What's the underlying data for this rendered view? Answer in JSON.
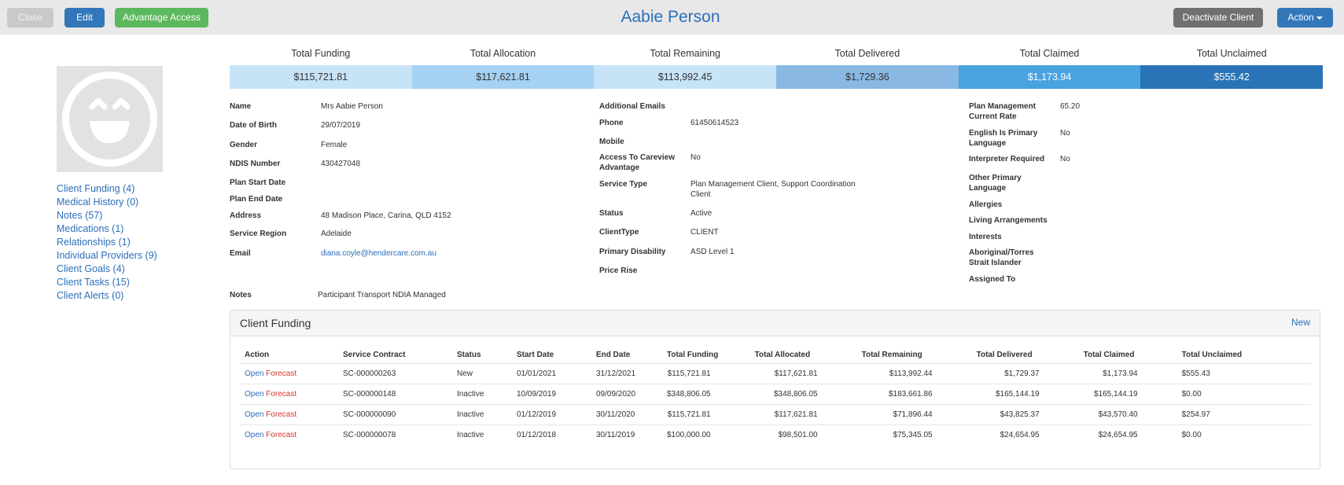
{
  "toolbar": {
    "close_label": "Close",
    "edit_label": "Edit",
    "advantage_label": "Advantage Access",
    "deactivate_label": "Deactivate Client",
    "action_label": "Action"
  },
  "page_title": "Aabie Person",
  "avatar_icon": "smiley-face-icon",
  "sidebar": {
    "items": [
      {
        "label": "Client Funding (4)"
      },
      {
        "label": "Medical History (0)"
      },
      {
        "label": "Notes (57)"
      },
      {
        "label": "Medications (1)"
      },
      {
        "label": "Relationships (1)"
      },
      {
        "label": "Individual Providers (9)"
      },
      {
        "label": "Client Goals (4)"
      },
      {
        "label": "Client Tasks (15)"
      },
      {
        "label": "Client Alerts (0)"
      }
    ]
  },
  "totals": [
    {
      "label": "Total Funding",
      "value": "$115,721.81",
      "color": "#c7e3f7",
      "text_color": "#333333"
    },
    {
      "label": "Total Allocation",
      "value": "$117,621.81",
      "color": "#a5d2f2",
      "text_color": "#333333"
    },
    {
      "label": "Total Remaining",
      "value": "$113,992.45",
      "color": "#c7e3f7",
      "text_color": "#333333"
    },
    {
      "label": "Total Delivered",
      "value": "$1,729.36",
      "color": "#89b9e3",
      "text_color": "#333333"
    },
    {
      "label": "Total Claimed",
      "value": "$1,173.94",
      "color": "#48a3e0",
      "text_color": "#ffffff"
    },
    {
      "label": "Total Unclaimed",
      "value": "$555.42",
      "color": "#2874b6",
      "text_color": "#ffffff"
    }
  ],
  "details": {
    "left": [
      {
        "label": "Name",
        "value": "Mrs Aabie Person"
      },
      {
        "label": "Date of Birth",
        "value": "29/07/2019"
      },
      {
        "label": "Gender",
        "value": "Female"
      },
      {
        "label": "NDIS Number",
        "value": "430427048"
      },
      {
        "label": "Plan Start Date",
        "value": ""
      },
      {
        "label": "Plan End Date",
        "value": ""
      },
      {
        "label": "Address",
        "value": "48 Madison Place, Carina, QLD 4152"
      },
      {
        "label": "Service Region",
        "value": "Adelaide"
      },
      {
        "label": "Email",
        "value": "diana.coyle@hendercare.com.au"
      }
    ],
    "middle": [
      {
        "label": "Additional Emails",
        "value": ""
      },
      {
        "label": "Phone",
        "value": "61450614523"
      },
      {
        "label": "Mobile",
        "value": ""
      },
      {
        "label_1": "Access To Careview",
        "label_2": "Advantage",
        "value": "No"
      },
      {
        "label": "Service Type",
        "value_1": "Plan Management Client, Support Coordination",
        "value_2": "Client"
      },
      {
        "label": "Status",
        "value": "Active"
      },
      {
        "label": "ClientType",
        "value": "CLIENT"
      },
      {
        "label": "Primary Disability",
        "value": "ASD Level 1"
      },
      {
        "label": "Price Rise",
        "value": ""
      }
    ],
    "right": [
      {
        "label_1": "Plan Management",
        "label_2": "Current Rate",
        "value": "65.20"
      },
      {
        "label_1": "English Is Primary",
        "label_2": "Language",
        "value": "No"
      },
      {
        "label": "Interpreter Required",
        "value": "No"
      },
      {
        "label_1": "Other Primary",
        "label_2": "Language",
        "value": ""
      },
      {
        "label": "Allergies",
        "value": ""
      },
      {
        "label": "Living Arrangements",
        "value": ""
      },
      {
        "label": "Interests",
        "value": ""
      },
      {
        "label_1": "Aboriginal/Torres",
        "label_2": "Strait Islander",
        "value": ""
      },
      {
        "label": "Assigned To",
        "value": ""
      }
    ],
    "notes_label": "Notes",
    "notes_value": "Participant Transport NDIA Managed"
  },
  "funding_panel": {
    "title": "Client Funding",
    "new_label": "New",
    "headers": [
      "Action",
      "Service Contract",
      "Status",
      "Start Date",
      "End Date",
      "Total Funding",
      "Total Allocated",
      "Total Remaining",
      "Total Delivered",
      "Total Claimed",
      "Total Unclaimed"
    ],
    "rows": [
      {
        "open": "Open",
        "forecast": "Forecast",
        "contract": "SC-000000263",
        "status": "New",
        "start": "01/01/2021",
        "end": "31/12/2021",
        "funding": "$115,721.81",
        "allocated": "$117,621.81",
        "remaining": "$113,992.44",
        "delivered": "$1,729.37",
        "claimed": "$1,173.94",
        "unclaimed": "$555.43"
      },
      {
        "open": "Open",
        "forecast": "Forecast",
        "contract": "SC-000000148",
        "status": "Inactive",
        "start": "10/09/2019",
        "end": "09/09/2020",
        "funding": "$348,806.05",
        "allocated": "$348,806.05",
        "remaining": "$183,661.86",
        "delivered": "$165,144.19",
        "claimed": "$165,144.19",
        "unclaimed": "$0.00"
      },
      {
        "open": "Open",
        "forecast": "Forecast",
        "contract": "SC-000000090",
        "status": "Inactive",
        "start": "01/12/2019",
        "end": "30/11/2020",
        "funding": "$115,721.81",
        "allocated": "$117,621.81",
        "remaining": "$71,896.44",
        "delivered": "$43,825.37",
        "claimed": "$43,570.40",
        "unclaimed": "$254.97"
      },
      {
        "open": "Open",
        "forecast": "Forecast",
        "contract": "SC-000000078",
        "status": "Inactive",
        "start": "01/12/2018",
        "end": "30/11/2019",
        "funding": "$100,000.00",
        "allocated": "$98,501.00",
        "remaining": "$75,345.05",
        "delivered": "$24,654.95",
        "claimed": "$24,654.95",
        "unclaimed": "$0.00"
      }
    ]
  }
}
